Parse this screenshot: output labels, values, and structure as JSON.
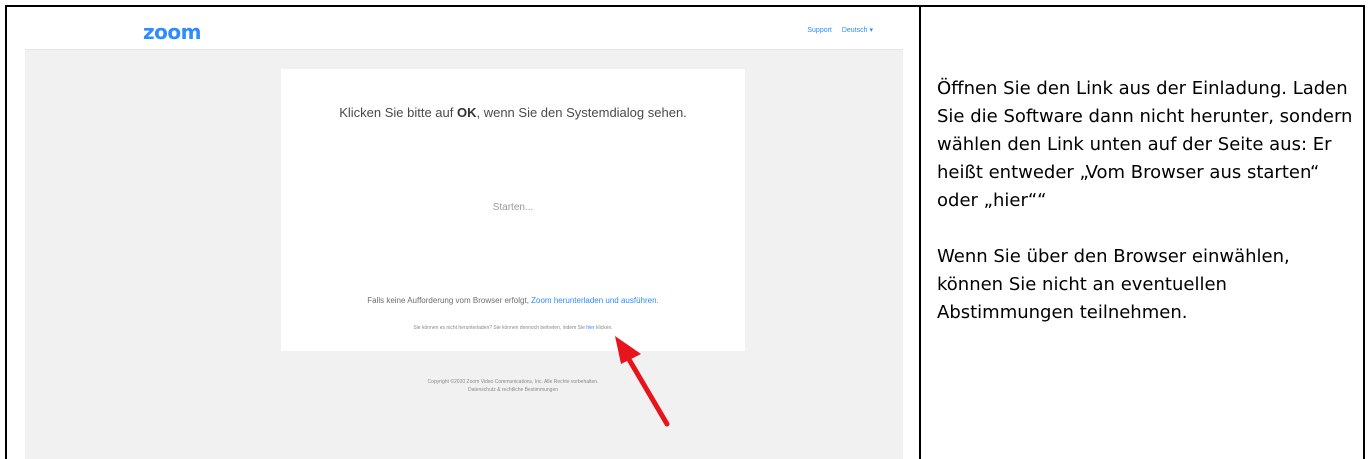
{
  "browser": {
    "logo": "zoom",
    "support_link": "Support",
    "language_menu": "Deutsch",
    "language_menu_caret": "▾",
    "card": {
      "title_before": "Klicken Sie bitte auf ",
      "title_bold": "OK",
      "title_after": ", wenn Sie den Systemdialog sehen.",
      "status": "Starten...",
      "fallback_text": "Falls keine Aufforderung vom Browser erfolgt, ",
      "fallback_link": "Zoom herunterladen und ausführen.",
      "small_text_before": "Sie können es nicht herunterladen? Sie können dennoch beitreten, indem Sie ",
      "small_link": "hier",
      "small_text_after": " klicken."
    },
    "copyright_line1": "Copyright ©2020 Zoom Video Communications, Inc. Alle Rechte vorbehalten.",
    "copyright_line2": "Datenschutz & rechtliche Bestimmungen"
  },
  "instructions": {
    "paragraph1": "Öffnen Sie den Link aus der Einladung. Laden Sie die Software dann nicht herunter, sondern wählen den Link unten auf der Seite aus: Er heißt entweder „Vom Browser aus starten“ oder „hier““",
    "paragraph2": "Wenn Sie über den Browser einwählen, können Sie nicht an eventuellen Abstimmungen teilnehmen."
  },
  "colors": {
    "zoom_blue": "#2d8cff",
    "arrow_red": "#e8141b",
    "page_gray": "#f1f1f1"
  }
}
